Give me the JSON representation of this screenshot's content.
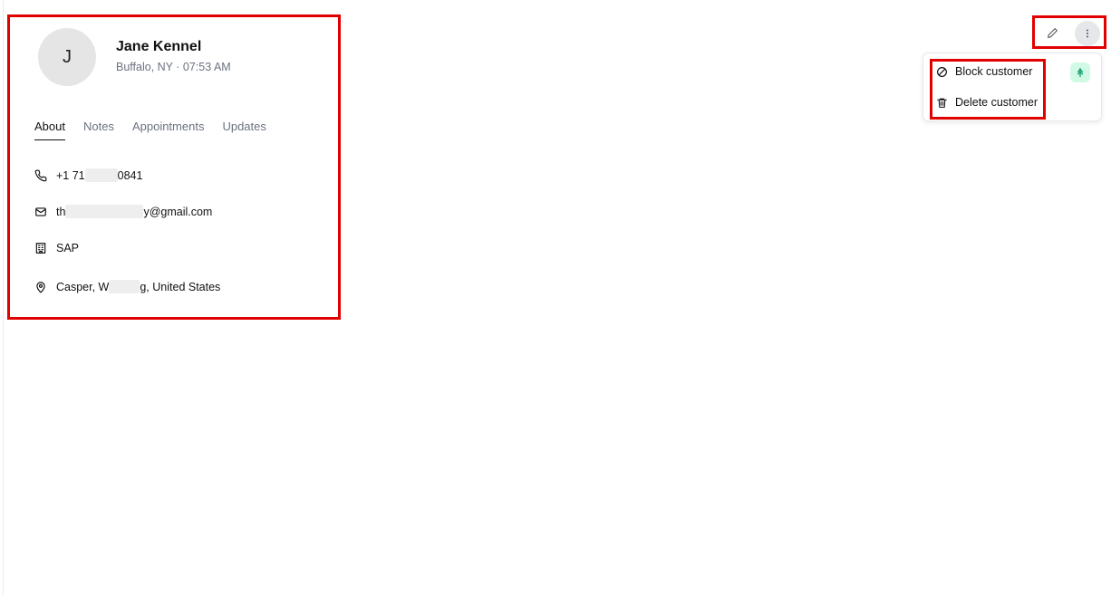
{
  "customer": {
    "initial": "J",
    "name": "Jane Kennel",
    "location_time": "Buffalo, NY · 07:53 AM"
  },
  "tabs": [
    {
      "label": "About",
      "active": true
    },
    {
      "label": "Notes",
      "active": false
    },
    {
      "label": "Appointments",
      "active": false
    },
    {
      "label": "Updates",
      "active": false
    }
  ],
  "about": {
    "phone_start": "+1 71",
    "phone_end": "0841",
    "email_start": "th",
    "email_end": "y@gmail.com",
    "company": "SAP",
    "address_start": "Casper, W",
    "address_end": "g, United States"
  },
  "menu": {
    "block_label": "Block customer",
    "delete_label": "Delete customer"
  },
  "icons": {
    "phone": "phone-icon",
    "email": "mail-icon",
    "company": "building-icon",
    "address": "map-pin-icon",
    "edit": "pencil-icon",
    "more": "more-vertical-icon",
    "block": "ban-icon",
    "delete": "trash-icon",
    "badge": "tree-icon"
  },
  "colors": {
    "highlight": "#e00000",
    "badge_bg": "#d1fae5",
    "badge_fg": "#059669"
  }
}
